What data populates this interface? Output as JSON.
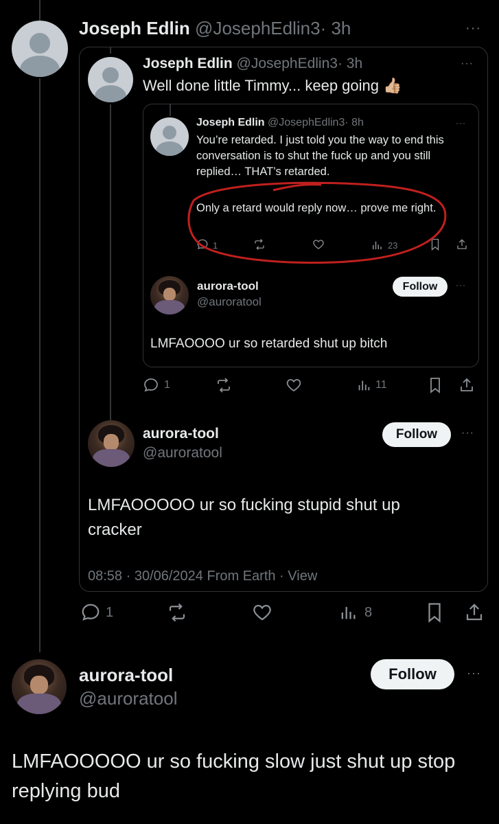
{
  "tweet1": {
    "name": "Joseph Edlin",
    "handle": "@JosephEdlin3",
    "time": "· 3h",
    "more": "···",
    "stats": {
      "replies": "1",
      "views": "8"
    }
  },
  "quote1": {
    "name": "Joseph Edlin",
    "handle": "@JosephEdlin3",
    "time": "· 3h",
    "more": "···",
    "text": "Well done little Timmy... keep going",
    "emoji": "👍🏼"
  },
  "quote2": {
    "name": "Joseph Edlin",
    "handle": "@JosephEdlin3",
    "time": "· 8h",
    "more": "···",
    "text": "You’re retarded. I just told you the way to end this conversation is to shut the fuck up and you still replied… THAT’s retarded.",
    "text2": "Only a retard would reply now… prove me right.",
    "stats": {
      "replies": "1",
      "views": "23"
    }
  },
  "quote2_reply": {
    "name": "aurora-tool",
    "handle": "@auroratool",
    "follow": "Follow",
    "more": "···",
    "text": "LMFAOOOO ur so retarded shut up bitch",
    "stats": {
      "replies": "1",
      "views": "11"
    }
  },
  "quote1_reply": {
    "name": "aurora-tool",
    "handle": "@auroratool",
    "follow": "Follow",
    "more": "···",
    "text": "LMFAOOOOO ur so fucking stupid shut up cracker",
    "meta": "08:58 · 30/06/2024 From Earth · View"
  },
  "main_reply": {
    "name": "aurora-tool",
    "handle": "@auroratool",
    "follow": "Follow",
    "more": "···",
    "text": "LMFAOOOOO ur so fucking slow just shut up stop replying bud"
  },
  "colors": {
    "background": "#000000",
    "text": "#e7e9ea",
    "muted": "#71767b",
    "border": "#2f3336",
    "annotation": "#c0201e"
  }
}
